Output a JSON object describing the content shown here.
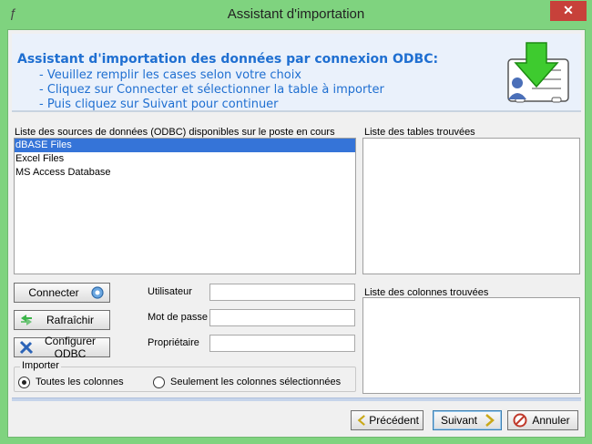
{
  "window": {
    "title": "Assistant d'importation",
    "close_label": "✕"
  },
  "header": {
    "title": "Assistant d'importation des données par connexion ODBC:",
    "lines": [
      "- Veuillez remplir les cases selon votre choix",
      "- Cliquez sur Connecter et sélectionner la table à importer",
      "- Puis cliquez sur Suivant pour continuer"
    ]
  },
  "sources": {
    "label": "Liste des sources de données (ODBC) disponibles sur le poste en cours",
    "items": [
      "dBASE Files",
      "Excel Files",
      "MS Access Database"
    ],
    "selected_index": 0
  },
  "tables": {
    "label": "Liste des tables trouvées"
  },
  "columns": {
    "label": "Liste des colonnes trouvées"
  },
  "buttons": {
    "connect": "Connecter",
    "refresh": "Rafraîchir",
    "configure": "Configurer ODBC",
    "previous": "Précédent",
    "next": "Suivant",
    "cancel": "Annuler"
  },
  "fields": {
    "user_label": "Utilisateur",
    "user_value": "",
    "password_label": "Mot de passe",
    "password_value": "",
    "owner_label": "Propriétaire",
    "owner_value": ""
  },
  "import_group": {
    "legend": "Importer",
    "options": [
      "Toutes les colonnes",
      "Seulement les colonnes sélectionnées"
    ],
    "selected_index": 0
  },
  "colors": {
    "accent_text": "#1f6fd1",
    "window_frame": "#7fd37f",
    "selection": "#3574d8"
  }
}
